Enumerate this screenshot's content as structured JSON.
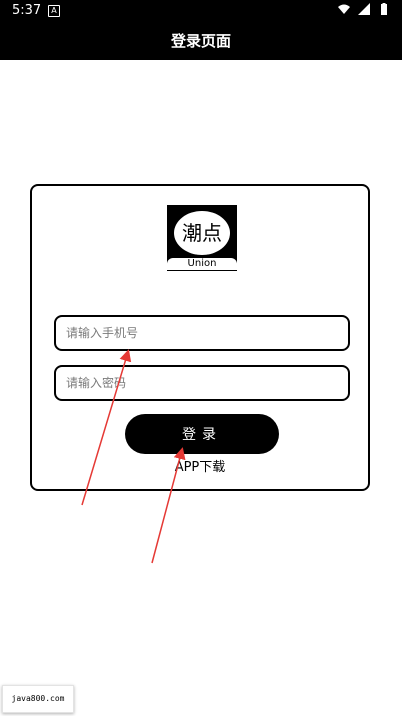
{
  "status": {
    "time": "5:37",
    "notification": "A"
  },
  "header": {
    "title": "登录页面"
  },
  "logo": {
    "chars": "潮点",
    "sub": "Union"
  },
  "form": {
    "phone_placeholder": "请输入手机号",
    "password_placeholder": "请输入密码",
    "login_label": "登录",
    "app_download": "APP下载"
  },
  "watermark": {
    "text": "java800.com"
  },
  "colors": {
    "bar": "#000000",
    "annotation_arrow": "#e53935"
  }
}
